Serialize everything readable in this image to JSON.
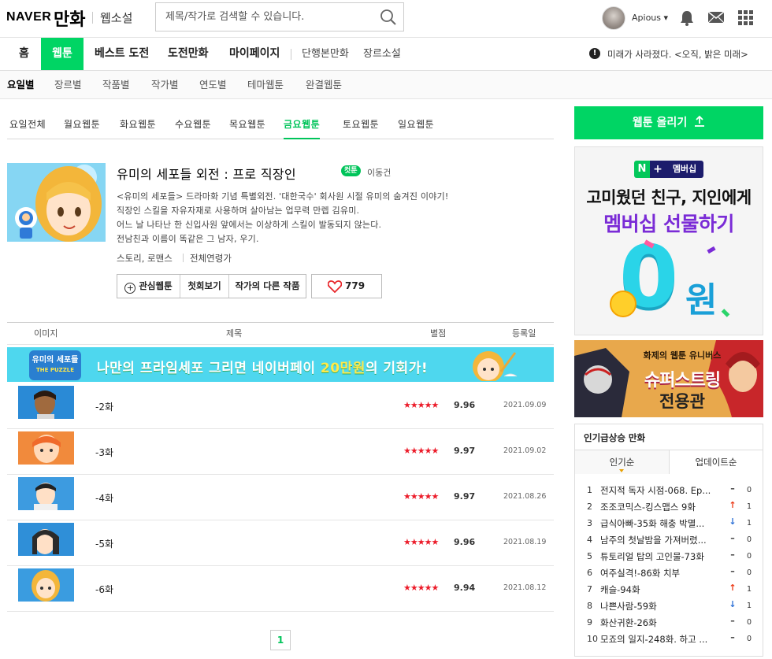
{
  "header": {
    "logo_naver": "NAVER",
    "logo_manhwa": "만화",
    "web_novel": "웹소설",
    "search_placeholder": "제목/작가로 검색할 수 있습니다.",
    "username": "Apious ▾"
  },
  "gnb": {
    "items": [
      "홈",
      "웹툰",
      "베스트 도전",
      "도전만화",
      "마이페이지",
      "단행본만화",
      "장르소설"
    ],
    "notice_icon": "!",
    "notice": "미래가 사라졌다. <오직, 밝은 미래>"
  },
  "snb": {
    "items": [
      "요일별",
      "장르별",
      "작품별",
      "작가별",
      "연도별",
      "테마웹툰",
      "완결웹툰"
    ]
  },
  "day_tabs": [
    "요일전체",
    "월요웹툰",
    "화요웹툰",
    "수요웹툰",
    "목요웹툰",
    "금요웹툰",
    "토요웹툰",
    "일요웹툰"
  ],
  "comic": {
    "title": "유미의 세포들 외전 : 프로 직장인",
    "badge": "컷툰",
    "author": "이동건",
    "description": [
      "<유미의 세포들> 드라마화 기념 특별외전. '대한국수' 회사원 시절 유미의 숨겨진 이야기!",
      "직장인 스킬을 자유자재로 사용하며 살아남는 업무력 만렙 김유미.",
      "어느 날 나타난 한 신입사원 앞에서는 이상하게 스킬이 발동되지 않는다.",
      "전남친과 이름이 똑같은 그 남자, 우기."
    ],
    "genre": "스토리, 로맨스",
    "age": "전체연령가",
    "buttons": {
      "favorite": "관심웹툰",
      "first": "첫회보기",
      "other": "작가의 다른 작품"
    },
    "likes": "779"
  },
  "table": {
    "headers": {
      "image": "이미지",
      "title": "제목",
      "rating": "별점",
      "date": "등록일"
    },
    "banner": {
      "part1": "나만의 프라임세포 그리면 네이버페이 ",
      "highlight": "20만원",
      "part2": "의 기회가!",
      "logo_text": "유미의 세포들",
      "logo_sub": "THE PUZZLE"
    },
    "rows": [
      {
        "title": "-2화",
        "stars": "★★★★★",
        "score": "9.96",
        "date": "2021.09.09"
      },
      {
        "title": "-3화",
        "stars": "★★★★★",
        "score": "9.97",
        "date": "2021.09.02"
      },
      {
        "title": "-4화",
        "stars": "★★★★★",
        "score": "9.97",
        "date": "2021.08.26"
      },
      {
        "title": "-5화",
        "stars": "★★★★★",
        "score": "9.96",
        "date": "2021.08.19"
      },
      {
        "title": "-6화",
        "stars": "★★★★★",
        "score": "9.94",
        "date": "2021.08.12"
      }
    ],
    "page": "1"
  },
  "sidebar": {
    "upload": "웹툰 올리기",
    "ad1": {
      "logo_n": "N",
      "logo_plus": "+",
      "logo_text": "멤버십",
      "line1": "고미웠던 친구, 지인에게",
      "line2": "멤버십 선물하기",
      "big_zero": "0",
      "won": "원"
    },
    "ad2": {
      "line1": "화제의 웹툰 유니버스",
      "line2": "슈퍼스트링",
      "line3": "전용관"
    },
    "popular": {
      "title": "인기급상승 만화",
      "tabs": [
        "인기순",
        "업데이트순"
      ],
      "items": [
        {
          "rank": "1",
          "title": "전지적 독자 시점-068. Ep...",
          "change": "same",
          "count": "0"
        },
        {
          "rank": "2",
          "title": "조조코믹스-킹스맵스 9화",
          "change": "up",
          "count": "1"
        },
        {
          "rank": "3",
          "title": "급식아빠-35화 해충 박멸...",
          "change": "down",
          "count": "1"
        },
        {
          "rank": "4",
          "title": "남주의 첫날밤을 가져버렸...",
          "change": "same",
          "count": "0"
        },
        {
          "rank": "5",
          "title": "튜토리얼 탑의 고인물-73화",
          "change": "same",
          "count": "0"
        },
        {
          "rank": "6",
          "title": "여주실격!-86화 치부",
          "change": "same",
          "count": "0"
        },
        {
          "rank": "7",
          "title": "캐슬-94화",
          "change": "up",
          "count": "1"
        },
        {
          "rank": "8",
          "title": "나쁜사람-59화",
          "change": "down",
          "count": "1"
        },
        {
          "rank": "9",
          "title": "화산귀환-26화",
          "change": "same",
          "count": "0"
        },
        {
          "rank": "10",
          "title": "모죠의 일지-248화. 하고 ...",
          "change": "same",
          "count": "0"
        }
      ]
    }
  },
  "colors": {
    "brand_green": "#00d564",
    "active_green": "#00c45a",
    "star_red": "#ec1c2a",
    "up": "#ec3b18",
    "down": "#2a6fd6"
  }
}
